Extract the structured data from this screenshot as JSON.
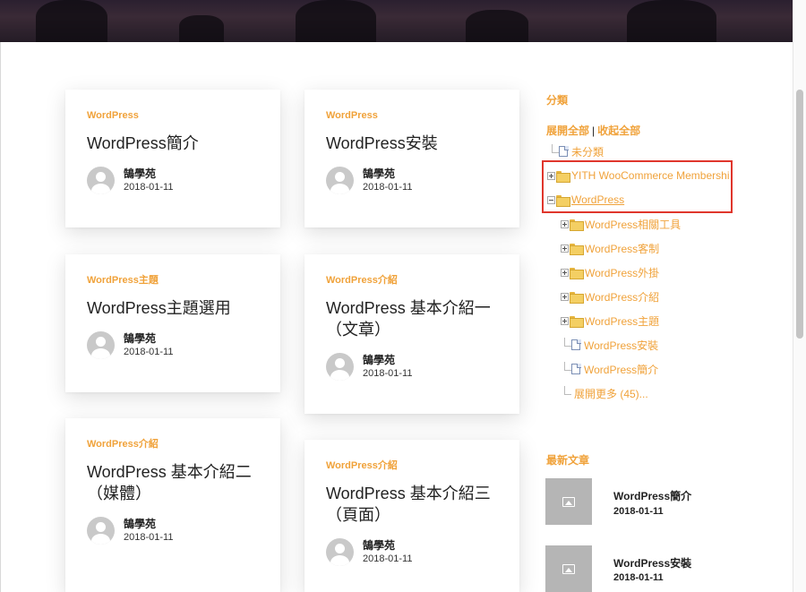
{
  "posts": [
    {
      "category": "WordPress",
      "title": "WordPress簡介",
      "author": "鵠學苑",
      "date": "2018-01-11"
    },
    {
      "category": "WordPress",
      "title": "WordPress安裝",
      "author": "鵠學苑",
      "date": "2018-01-11"
    },
    {
      "category": "WordPress主題",
      "title": "WordPress主題選用",
      "author": "鵠學苑",
      "date": "2018-01-11"
    },
    {
      "category": "WordPress介紹",
      "title": "WordPress 基本介紹一（文章）",
      "author": "鵠學苑",
      "date": "2018-01-11"
    },
    {
      "category": "WordPress介紹",
      "title": "WordPress 基本介紹二（媒體）",
      "author": "鵠學苑",
      "date": "2018-01-11"
    },
    {
      "category": "WordPress介紹",
      "title": "WordPress 基本介紹三（頁面）",
      "author": "鵠學苑",
      "date": "2018-01-11"
    }
  ],
  "sidebar": {
    "categories_title": "分類",
    "expand_all": "展開全部",
    "separator": "|",
    "collapse_all": "收起全部",
    "tree": [
      {
        "label": "未分類",
        "icon": "page-icon"
      },
      {
        "label": "YITH WooCommerce Membership",
        "icon": "folder-icon"
      },
      {
        "label": "WordPress",
        "icon": "folder-icon"
      },
      {
        "label": "WordPress相關工具",
        "icon": "folder-icon"
      },
      {
        "label": "WordPress客制",
        "icon": "folder-icon"
      },
      {
        "label": "WordPress外掛",
        "icon": "folder-icon"
      },
      {
        "label": "WordPress介紹",
        "icon": "folder-icon"
      },
      {
        "label": "WordPress主題",
        "icon": "folder-icon"
      },
      {
        "label": "WordPress安裝",
        "icon": "page-icon"
      },
      {
        "label": "WordPress簡介",
        "icon": "page-icon"
      },
      {
        "label": "展開更多 (45)...",
        "icon": "page-icon"
      }
    ],
    "recent_title": "最新文章",
    "recent": [
      {
        "title": "WordPress簡介",
        "date": "2018-01-11"
      },
      {
        "title": "WordPress安裝",
        "date": "2018-01-11"
      }
    ]
  },
  "colors": {
    "accent": "#f0a23a",
    "highlight": "#e0362c"
  }
}
